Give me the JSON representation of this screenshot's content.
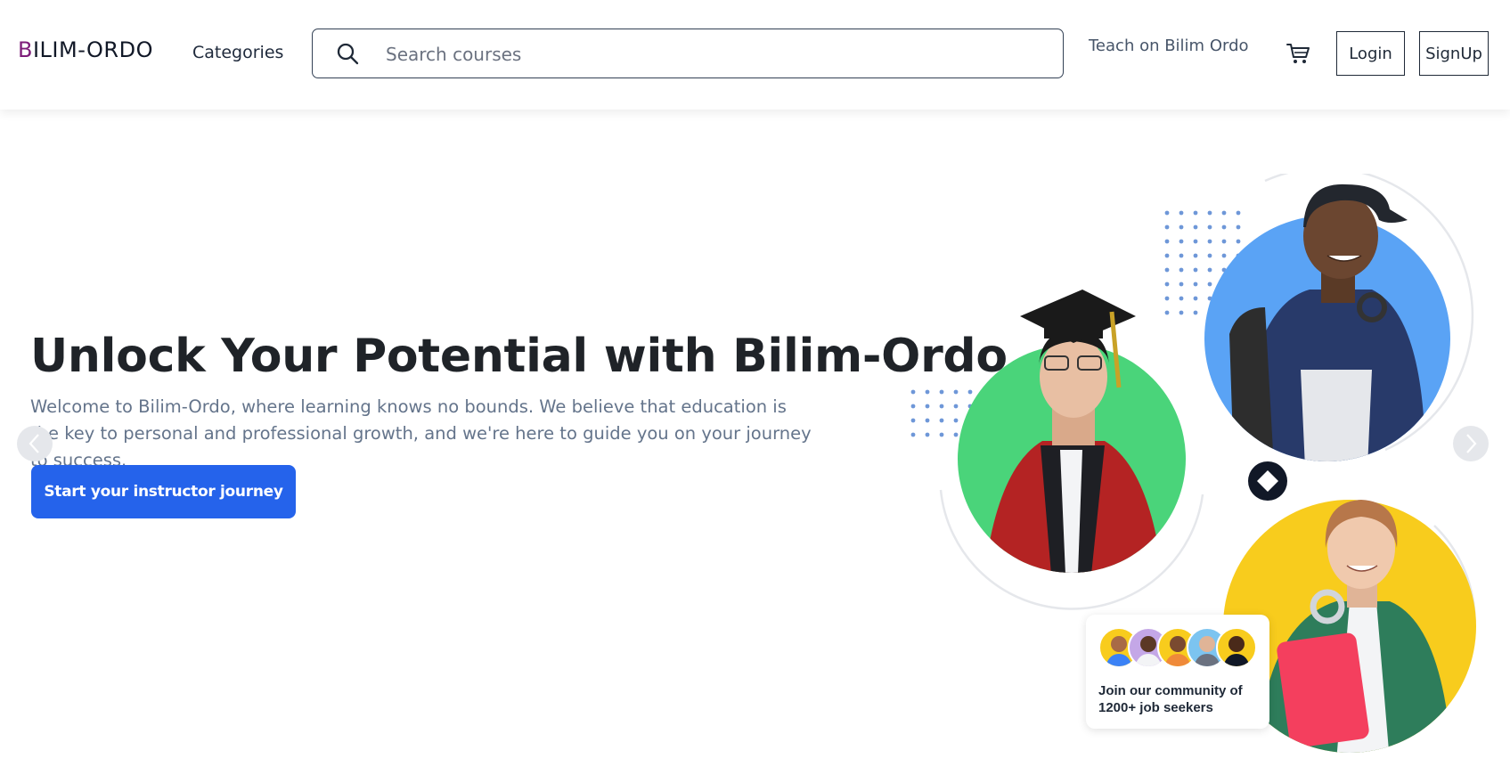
{
  "header": {
    "logo_first": "B",
    "logo_rest": "ILIM-ORDO",
    "categories": "Categories",
    "search_placeholder": "Search courses",
    "teach_link": "Teach on Bilim Ordo",
    "login": "Login",
    "signup": "SignUp"
  },
  "hero": {
    "headline": "Unlock Your Potential with Bilim-Ordo",
    "subtext": "Welcome to Bilim-Ordo, where learning knows no bounds. We believe that education is the key to personal and professional growth, and we're here to guide you on your journey to success.",
    "cta": "Start your instructor journey"
  },
  "illustration": {
    "community_text": "Join our community of 1200+ job seekers",
    "colors": {
      "green": "#4ad47a",
      "blue": "#5aa3f5",
      "yellow": "#f8cc1d",
      "dots": "#6e97d8",
      "badge": "#111827"
    }
  },
  "colors": {
    "brand_b": "#7e1d7a",
    "cta": "#2563eb",
    "text_muted": "#64748b"
  }
}
